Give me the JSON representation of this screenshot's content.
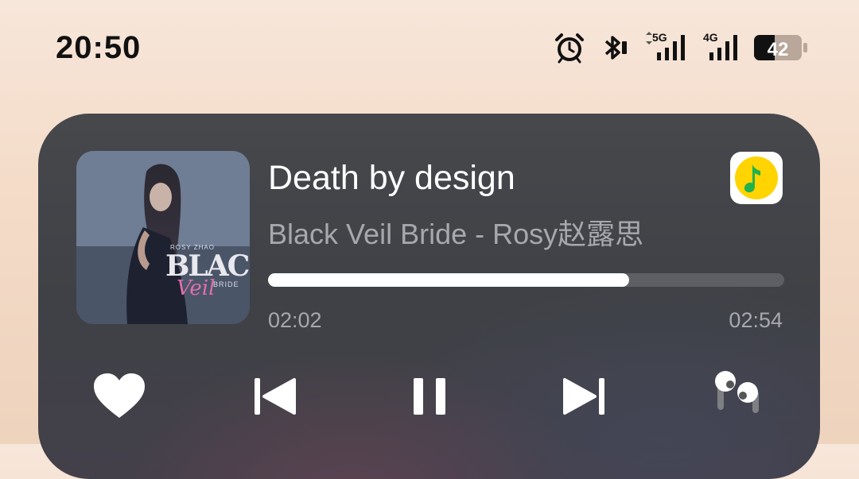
{
  "status_bar": {
    "time": "20:50",
    "icons": [
      "alarm-icon",
      "bluetooth-icon",
      "signal-5g-icon",
      "signal-4g-icon",
      "battery-icon"
    ],
    "network_1": "5G",
    "network_2": "4G",
    "battery_level": "42"
  },
  "player": {
    "album_art": {
      "artist_text": "ROSY ZHAO",
      "title_main": "BLACK",
      "title_script": "Veil",
      "title_small": "BRIDE"
    },
    "track_title": "Death by design",
    "track_subtitle": "Black Veil Bride - Rosy赵露思",
    "app_icon": "qq-music-icon",
    "progress_fraction": 0.7,
    "elapsed": "02:02",
    "total": "02:54",
    "controls": [
      "heart-icon",
      "previous-icon",
      "pause-icon",
      "next-icon",
      "earbuds-icon"
    ]
  },
  "colors": {
    "card_bg": "#434549",
    "accent_green": "#23b14d",
    "accent_yellow": "#ffd400",
    "text_secondary": "#a6a8ad"
  }
}
